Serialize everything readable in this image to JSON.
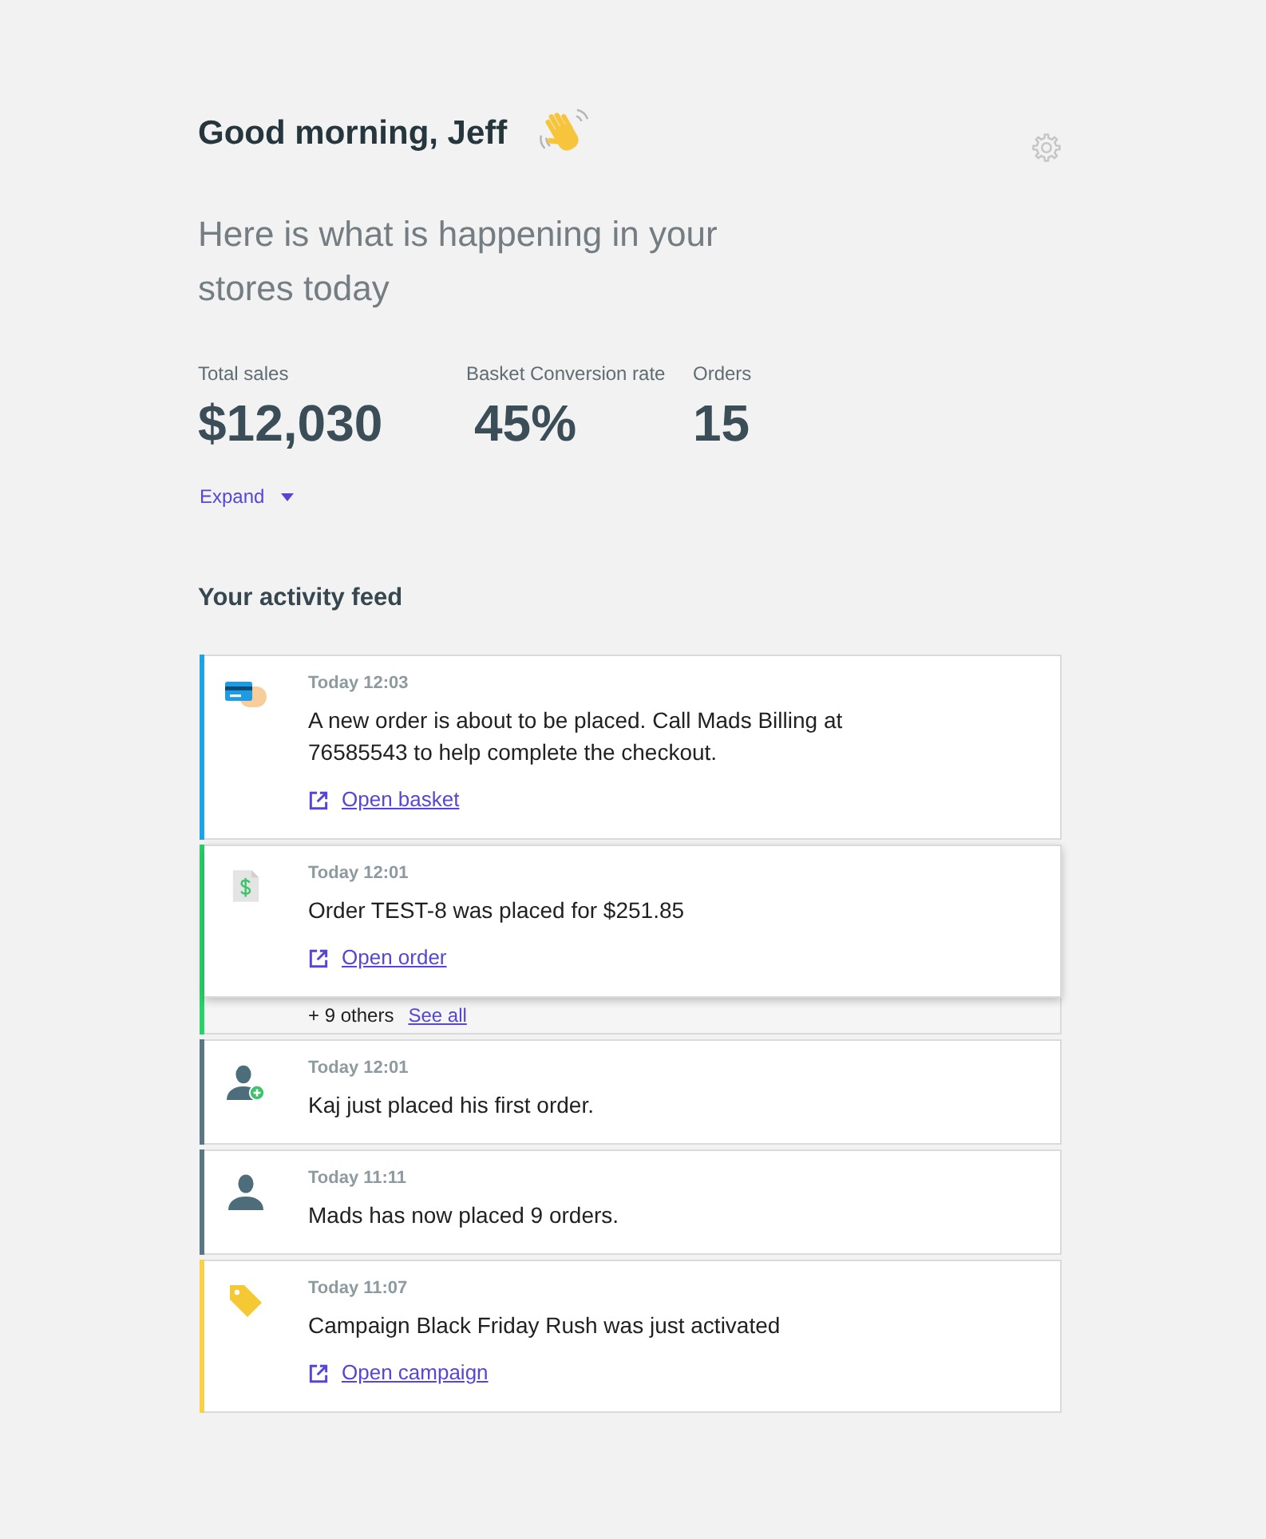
{
  "greeting": {
    "title": "Good morning, Jeff"
  },
  "subtitle": "Here is what is happening in your stores today",
  "stats": [
    {
      "label": "Total sales",
      "value": "$12,030"
    },
    {
      "label": "Basket Conversion rate",
      "value": "45%"
    },
    {
      "label": "Orders",
      "value": "15"
    }
  ],
  "expand": {
    "label": "Expand",
    "expanded": false
  },
  "feed": {
    "title": "Your activity feed",
    "items": [
      {
        "kind": "basket",
        "color": "#1ea3e6",
        "time": "Today 12:03",
        "text": "A new order is about to be placed. Call Mads Billing at 76585543 to help complete the checkout.",
        "link": "Open basket"
      },
      {
        "kind": "order",
        "color": "#2bd169",
        "time": "Today 12:01",
        "text": "Order TEST-8 was placed for $251.85",
        "link": "Open order",
        "others": {
          "count": "+ 9 others",
          "link": "See all"
        }
      },
      {
        "kind": "new_customer",
        "color": "#5b7684",
        "time": "Today 12:01",
        "text": "Kaj just placed his first order."
      },
      {
        "kind": "customer",
        "color": "#5b7684",
        "time": "Today 11:11",
        "text": "Mads has now placed 9 orders."
      },
      {
        "kind": "campaign",
        "color": "#f7d149",
        "time": "Today 11:07",
        "text": "Campaign Black Friday Rush was just activated",
        "link": "Open campaign"
      }
    ]
  }
}
